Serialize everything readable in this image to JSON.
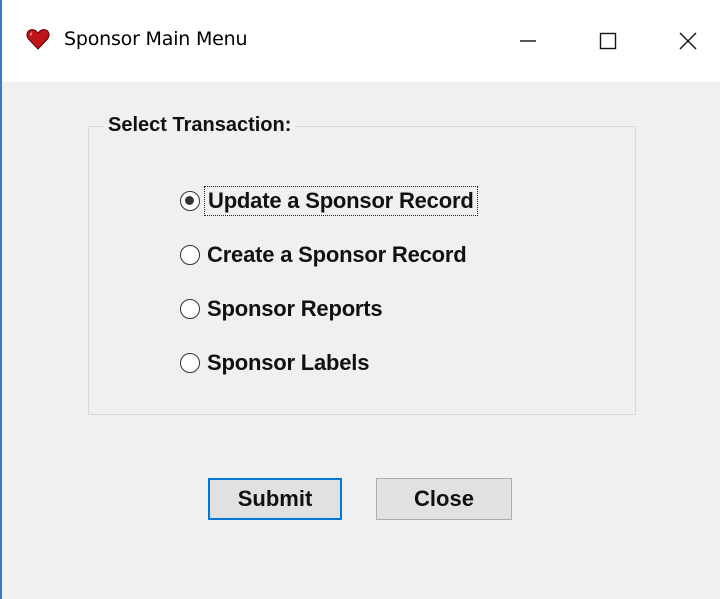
{
  "window": {
    "title": "Sponsor Main Menu",
    "icon": "heart-icon",
    "controls": {
      "minimize": "minimize-icon",
      "maximize": "maximize-icon",
      "close": "close-icon"
    }
  },
  "group": {
    "legend": "Select Transaction:",
    "options": [
      {
        "label": "Update a Sponsor Record",
        "selected": true
      },
      {
        "label": "Create a Sponsor Record",
        "selected": false
      },
      {
        "label": "Sponsor Reports",
        "selected": false
      },
      {
        "label": "Sponsor Labels",
        "selected": false
      }
    ]
  },
  "buttons": {
    "submit": "Submit",
    "close": "Close"
  },
  "colors": {
    "accent": "#0078d7",
    "background": "#f0f0f0",
    "border": "#3a78c9",
    "icon": "#c0141c"
  }
}
